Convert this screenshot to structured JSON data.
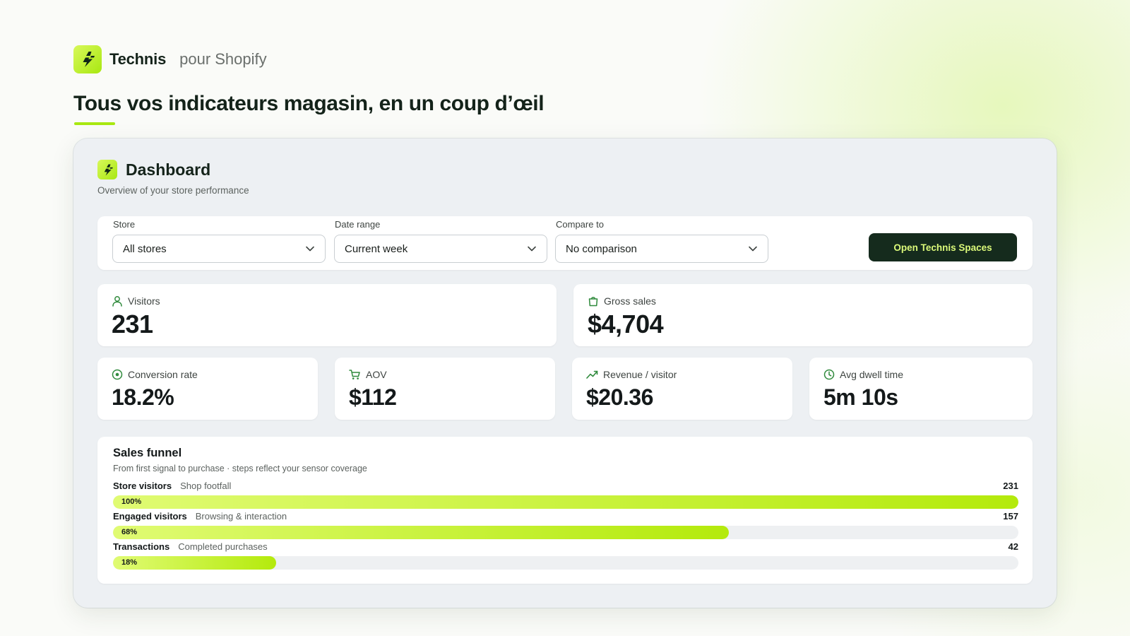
{
  "brand": {
    "name": "Technis",
    "suffix": "pour Shopify"
  },
  "headline": "Tous vos indicateurs magasin, en un coup d’œil",
  "dashboard": {
    "title": "Dashboard",
    "subtitle": "Overview of your store performance"
  },
  "filters": {
    "store": {
      "label": "Store",
      "value": "All stores"
    },
    "date_range": {
      "label": "Date range",
      "value": "Current week"
    },
    "compare": {
      "label": "Compare to",
      "value": "No comparison"
    },
    "cta_label": "Open Technis Spaces"
  },
  "kpis": {
    "visitors": {
      "label": "Visitors",
      "value": "231",
      "icon": "person-icon"
    },
    "gross_sales": {
      "label": "Gross sales",
      "value": "$4,704",
      "icon": "shopping-bag-icon"
    },
    "conversion_rate": {
      "label": "Conversion rate",
      "value": "18.2%",
      "icon": "target-icon"
    },
    "aov": {
      "label": "AOV",
      "value": "$112",
      "icon": "cart-icon"
    },
    "revenue_per_visitor": {
      "label": "Revenue / visitor",
      "value": "$20.36",
      "icon": "trend-up-icon"
    },
    "avg_dwell_time": {
      "label": "Avg dwell time",
      "value": "5m 10s",
      "icon": "clock-icon"
    }
  },
  "funnel": {
    "title": "Sales funnel",
    "subtitle": "From first signal to purchase · steps reflect your sensor coverage",
    "steps": [
      {
        "name": "Store visitors",
        "desc": "Shop footfall",
        "count": "231",
        "pct_label": "100%",
        "fraction": 1.0
      },
      {
        "name": "Engaged visitors",
        "desc": "Browsing & interaction",
        "count": "157",
        "pct_label": "68%",
        "fraction": 0.68
      },
      {
        "name": "Transactions",
        "desc": "Completed purchases",
        "count": "42",
        "pct_label": "18%",
        "fraction": 0.18
      }
    ]
  },
  "colors": {
    "accent": "#b4ea0c",
    "accent_light": "#e0fb73",
    "dark": "#152b1d",
    "icon_green": "#2f8a3c"
  }
}
